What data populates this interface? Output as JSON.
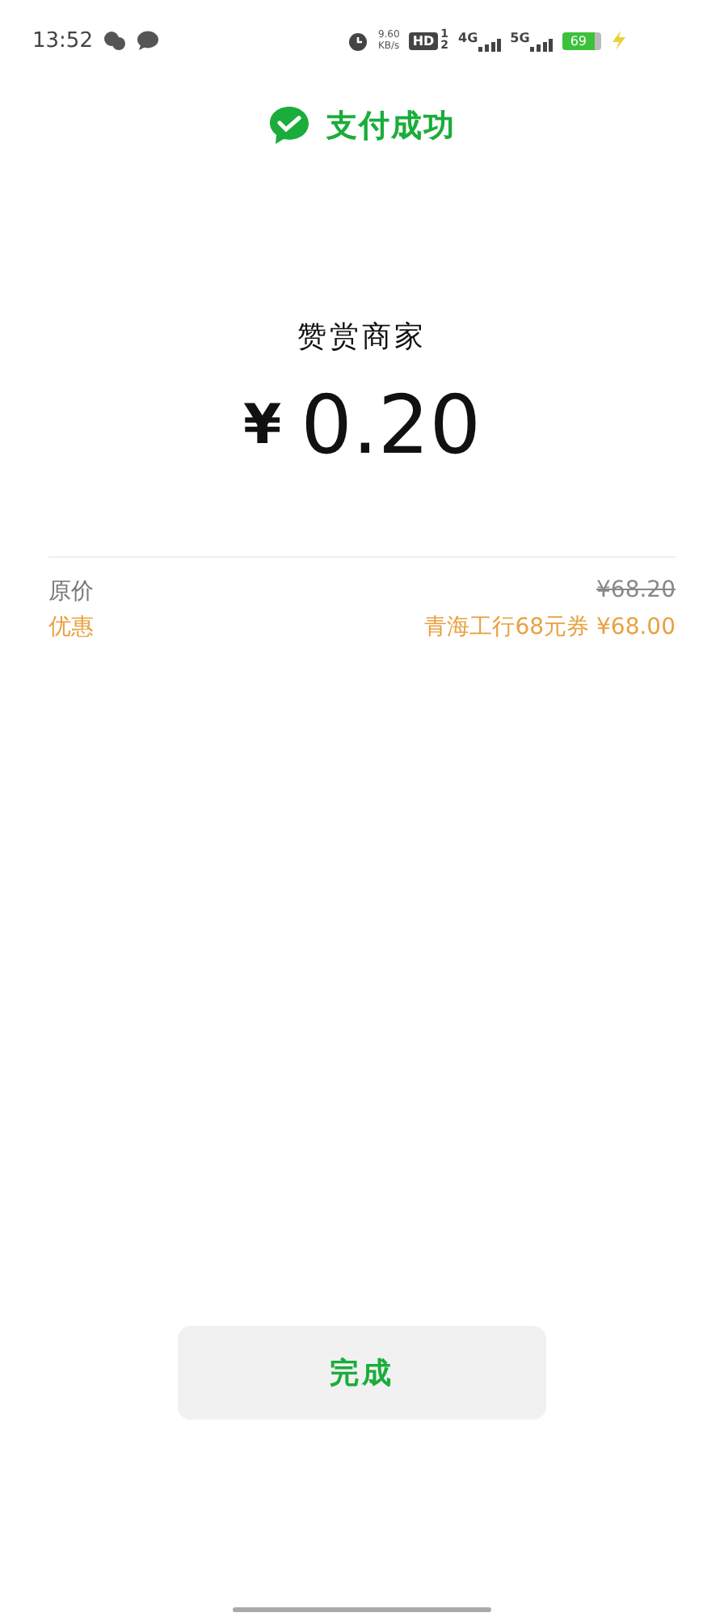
{
  "status_bar": {
    "time": "13:52",
    "speed_value": "9.60",
    "speed_unit": "KB/s",
    "hd_label": "HD",
    "sim_slots": [
      "1",
      "2"
    ],
    "networks": [
      {
        "label": "4G"
      },
      {
        "label": "5G"
      }
    ],
    "battery": "69",
    "charging": true
  },
  "header": {
    "title": "支付成功"
  },
  "merchant": "赞赏商家",
  "amount": {
    "currency": "¥",
    "value": "0.20"
  },
  "rows": [
    {
      "label": "原价",
      "value": "¥68.20",
      "kind": "original"
    },
    {
      "label": "优惠",
      "value": "青海工行68元券 ¥68.00",
      "kind": "discount"
    }
  ],
  "button": {
    "label": "完成"
  }
}
